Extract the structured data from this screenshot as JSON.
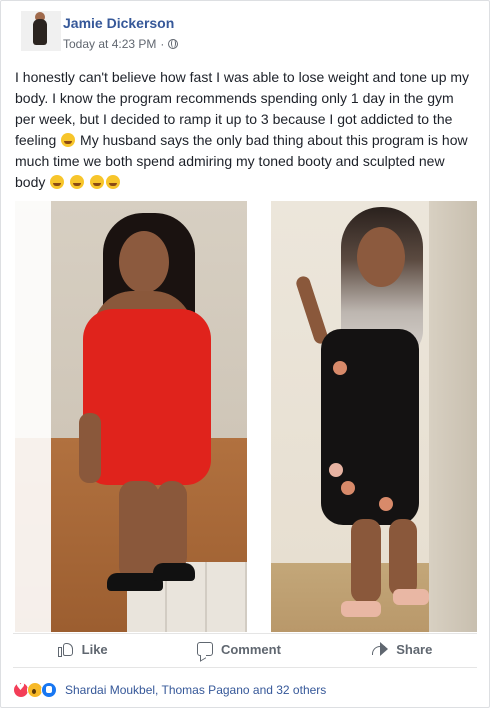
{
  "post": {
    "author": "Jamie Dickerson",
    "timestamp": "Today at 4:23 PM",
    "separator": "·",
    "privacy_icon": "globe-icon",
    "text_part1": "I honestly can't believe how fast I was able to lose weight and tone up my body. I know the program recommends spending only 1 day in the gym per week, but I decided to ramp it up to 3 because I got addicted to the feeling",
    "text_part2": " My husband says the only bad thing about this program is how much time we both spend admiring my toned booty and sculpted new body"
  },
  "actions": {
    "like_label": "Like",
    "comment_label": "Comment",
    "share_label": "Share"
  },
  "reactions": {
    "icons": [
      "love-reaction-icon",
      "wow-reaction-icon",
      "like-reaction-icon"
    ],
    "summary": "Shardai Moukbel, Thomas Pagano and 32 others"
  },
  "colors": {
    "link_blue": "#365899",
    "secondary_text": "#616770",
    "action_text": "#606770"
  }
}
